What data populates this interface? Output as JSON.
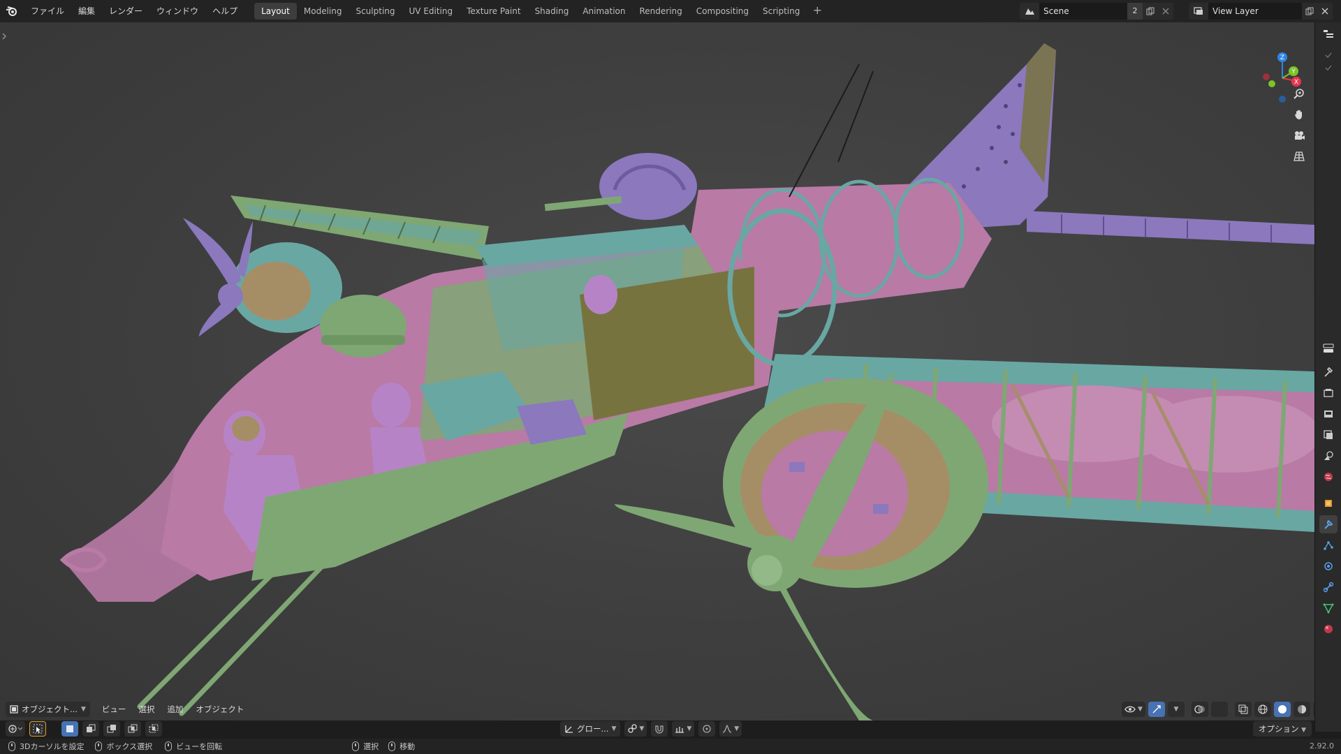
{
  "topbar": {
    "menus": [
      "ファイル",
      "編集",
      "レンダー",
      "ウィンドウ",
      "ヘルプ"
    ],
    "workspaces": [
      "Layout",
      "Modeling",
      "Sculpting",
      "UV Editing",
      "Texture Paint",
      "Shading",
      "Animation",
      "Rendering",
      "Compositing",
      "Scripting"
    ],
    "active_workspace": "Layout",
    "add_label": "+",
    "scene": {
      "name": "Scene",
      "users": "2"
    },
    "view_layer": {
      "name": "View Layer"
    }
  },
  "viewport": {
    "gizmo": {
      "x_label": "X",
      "y_label": "Y",
      "z_label": "Z",
      "x_color": "#e8364e",
      "y_color": "#7dc32a",
      "z_color": "#2d86e6"
    },
    "nav_icons": [
      "zoom-icon",
      "hand-pan-icon",
      "camera-icon",
      "grid-perspective-icon"
    ],
    "header": {
      "mode": "オブジェクト...",
      "menus": [
        "ビュー",
        "選択",
        "追加",
        "オブジェクト"
      ]
    },
    "transform_orientation": "グロー...",
    "options": "オプション"
  },
  "status": {
    "items": [
      {
        "icon": "mouse-left-icon",
        "label": "3Dカーソルを設定"
      },
      {
        "icon": "mouse-left-drag-icon",
        "label": "ボックス選択"
      },
      {
        "icon": "mouse-middle-icon",
        "label": "ビューを回転"
      },
      {
        "icon": "mouse-left-icon",
        "label": "選択"
      },
      {
        "icon": "mouse-left-drag-icon",
        "label": "移動"
      }
    ],
    "version": "2.92.0"
  },
  "colors": {
    "pink": "#b97aa6",
    "green": "#7fa774",
    "teal": "#69a7a3",
    "purple": "#8b78bd",
    "tan": "#a58e66",
    "olive": "#77733f",
    "viewport_bg": "#3e3e3e"
  }
}
